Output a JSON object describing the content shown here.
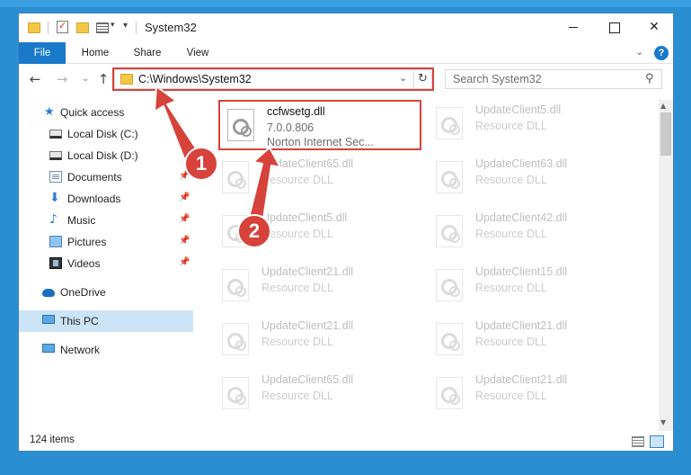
{
  "window": {
    "title": "System32",
    "controls": {
      "minimize": "",
      "maximize": "",
      "close": "✕"
    }
  },
  "ribbon": {
    "tabs": [
      "File",
      "Home",
      "Share",
      "View"
    ],
    "expand_icon": "chevron-down-icon",
    "help_label": "?"
  },
  "navigation": {
    "back": "←",
    "forward": "→",
    "recent": "⌄",
    "up": "↑",
    "address": "C:\\Windows\\System32",
    "address_dropdown": "⌄",
    "refresh": "↻",
    "search_placeholder": "Search System32",
    "search_icon": "⚲"
  },
  "sidebar": {
    "items": [
      {
        "label": "Quick access",
        "icon": "star-icon",
        "pinned": false
      },
      {
        "label": "Local Disk (C:)",
        "icon": "disk-icon",
        "pinned": false
      },
      {
        "label": "Local Disk (D:)",
        "icon": "disk-icon",
        "pinned": false
      },
      {
        "label": "Documents",
        "icon": "documents-icon",
        "pinned": true
      },
      {
        "label": "Downloads",
        "icon": "downloads-icon",
        "pinned": true
      },
      {
        "label": "Music",
        "icon": "music-icon",
        "pinned": true
      },
      {
        "label": "Pictures",
        "icon": "pictures-icon",
        "pinned": true
      },
      {
        "label": "Videos",
        "icon": "videos-icon",
        "pinned": true
      },
      {
        "label": "OneDrive",
        "icon": "onedrive-icon",
        "pinned": false
      },
      {
        "label": "This PC",
        "icon": "this-pc-icon",
        "pinned": false,
        "selected": true
      },
      {
        "label": "Network",
        "icon": "network-icon",
        "pinned": false
      }
    ],
    "pin_glyph": "📌"
  },
  "files": {
    "featured": {
      "name": "ccfwsetg.dll",
      "version": "7.0.0.806",
      "description": "Norton Internet Sec..."
    },
    "left_column": [
      {
        "name": "UpdateClient65.dll",
        "description": "Resource DLL"
      },
      {
        "name": "UpdateClient5.dll",
        "description": "Resource DLL"
      },
      {
        "name": "UpdateClient21.dll",
        "description": "Resource DLL"
      },
      {
        "name": "UpdateClient21.dll",
        "description": "Resource DLL"
      },
      {
        "name": "UpdateClient65.dll",
        "description": "Resource DLL"
      }
    ],
    "right_column": [
      {
        "name": "UpdateClient5.dll",
        "description": "Resource DLL"
      },
      {
        "name": "UpdateClient63.dll",
        "description": "Resource DLL"
      },
      {
        "name": "UpdateClient42.dll",
        "description": "Resource DLL"
      },
      {
        "name": "UpdateClient15.dll",
        "description": "Resource DLL"
      },
      {
        "name": "UpdateClient21.dll",
        "description": "Resource DLL"
      },
      {
        "name": "UpdateClient21.dll",
        "description": "Resource DLL"
      }
    ]
  },
  "status": {
    "item_count": "124 items"
  },
  "callouts": [
    "1",
    "2"
  ],
  "colors": {
    "accent": "#1979ca",
    "highlight": "#d7423a",
    "desktop": "#2a8fd0"
  }
}
